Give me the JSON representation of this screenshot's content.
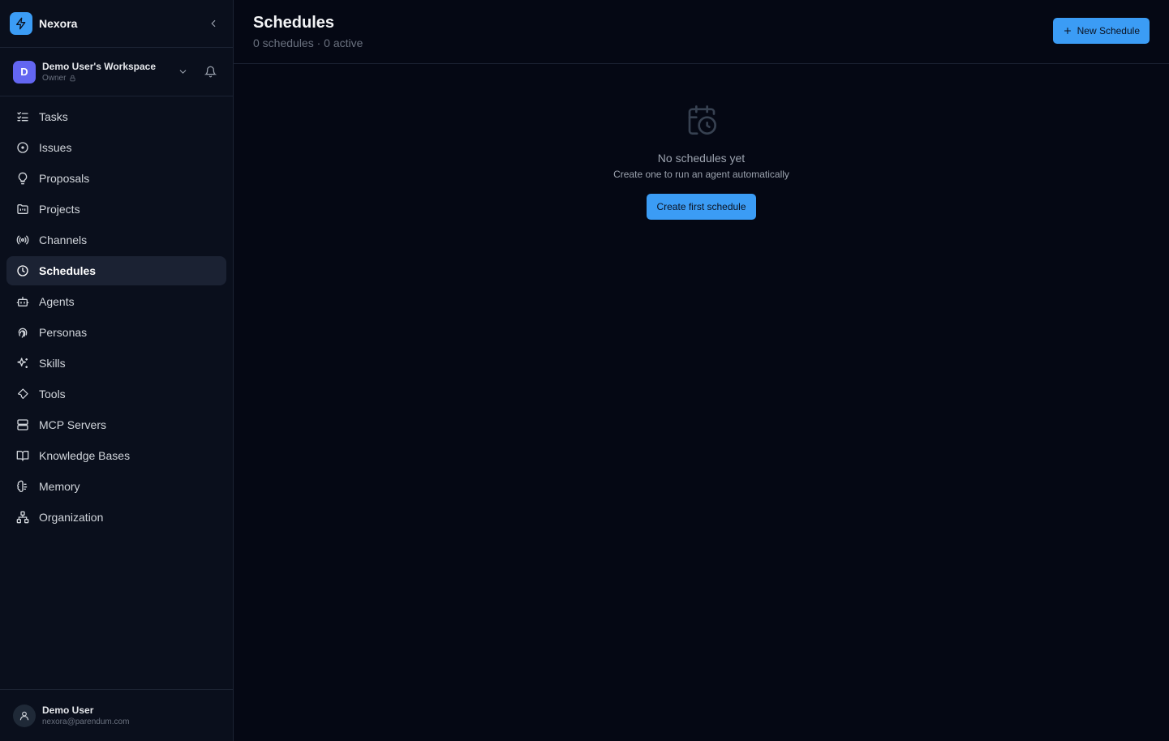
{
  "brand": {
    "name": "Nexora"
  },
  "workspace": {
    "initial": "D",
    "name": "Demo User's Workspace",
    "role": "Owner"
  },
  "nav": {
    "items": [
      {
        "label": "Tasks",
        "icon": "tasks-icon"
      },
      {
        "label": "Issues",
        "icon": "circle-dot-icon"
      },
      {
        "label": "Proposals",
        "icon": "lightbulb-icon"
      },
      {
        "label": "Projects",
        "icon": "folder-icon"
      },
      {
        "label": "Channels",
        "icon": "radio-icon"
      },
      {
        "label": "Schedules",
        "icon": "clock-icon",
        "active": true
      },
      {
        "label": "Agents",
        "icon": "bot-icon"
      },
      {
        "label": "Personas",
        "icon": "fingerprint-icon"
      },
      {
        "label": "Skills",
        "icon": "sparkles-icon"
      },
      {
        "label": "Tools",
        "icon": "wrench-icon"
      },
      {
        "label": "MCP Servers",
        "icon": "server-icon"
      },
      {
        "label": "Knowledge Bases",
        "icon": "book-icon"
      },
      {
        "label": "Memory",
        "icon": "brain-icon"
      },
      {
        "label": "Organization",
        "icon": "network-icon"
      }
    ]
  },
  "user": {
    "name": "Demo User",
    "email": "nexora@parendum.com"
  },
  "header": {
    "title": "Schedules",
    "subtitle": "0 schedules · 0 active",
    "new_button": "New Schedule"
  },
  "empty": {
    "title": "No schedules yet",
    "subtitle": "Create one to run an agent automatically",
    "button": "Create first schedule"
  },
  "colors": {
    "accent": "#3b9cf5",
    "background": "#050814",
    "sidebar": "#0a0f1c",
    "workspace_avatar": "#6366f1"
  }
}
